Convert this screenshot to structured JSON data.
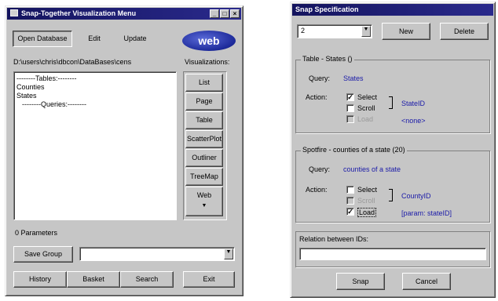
{
  "menu_window": {
    "title": "Snap-Together Visualization Menu",
    "titlebar_buttons": {
      "minimize": "_",
      "maximize": "□",
      "close": "×"
    },
    "buttons": {
      "open_database": "Open Database",
      "edit": "Edit",
      "update": "Update"
    },
    "logo_text": "web",
    "db_path": "D:\\users\\chris\\dbcon\\DataBases\\cens",
    "visualizations_label": "Visualizations:",
    "tree_items": [
      "--------Tables:--------",
      "Counties",
      "States",
      "--------Queries:--------"
    ],
    "vis_buttons": [
      "List",
      "Page",
      "Table",
      "ScatterPlot",
      "Outliner",
      "TreeMap",
      "Web"
    ],
    "vis_more_arrow": "▼",
    "parameters_text": "0 Parameters",
    "save_group_label": "Save Group",
    "group_combo_value": "",
    "bottom_buttons": {
      "history": "History",
      "basket": "Basket",
      "search": "Search",
      "exit": "Exit"
    }
  },
  "spec_window": {
    "title": "Snap Specification",
    "combo_value": "2",
    "buttons": {
      "new": "New",
      "delete": "Delete",
      "snap": "Snap",
      "cancel": "Cancel"
    },
    "group1": {
      "title": "Table - States ()",
      "query_label": "Query:",
      "query_value": "States",
      "action_label": "Action:",
      "actions": [
        {
          "label": "Select",
          "checked": true,
          "enabled": true
        },
        {
          "label": "Scroll",
          "checked": false,
          "enabled": true
        },
        {
          "label": "Load",
          "checked": false,
          "enabled": false
        }
      ],
      "key_label": "StateID",
      "param_label": "<none>"
    },
    "group2": {
      "title": "Spotfire - counties of a state (20)",
      "query_label": "Query:",
      "query_value": "counties of a state",
      "action_label": "Action:",
      "actions": [
        {
          "label": "Select",
          "checked": false,
          "enabled": true
        },
        {
          "label": "Scroll",
          "checked": false,
          "enabled": false
        },
        {
          "label": "Load",
          "checked": true,
          "enabled": true
        }
      ],
      "key_label": "CountyID",
      "param_label": "[param: stateID]"
    },
    "relation_label": "Relation between IDs:",
    "relation_value": ""
  },
  "colors": {
    "titlebar": "#1c1c70",
    "face": "#c6c6c6",
    "link": "#1a1aa8"
  }
}
